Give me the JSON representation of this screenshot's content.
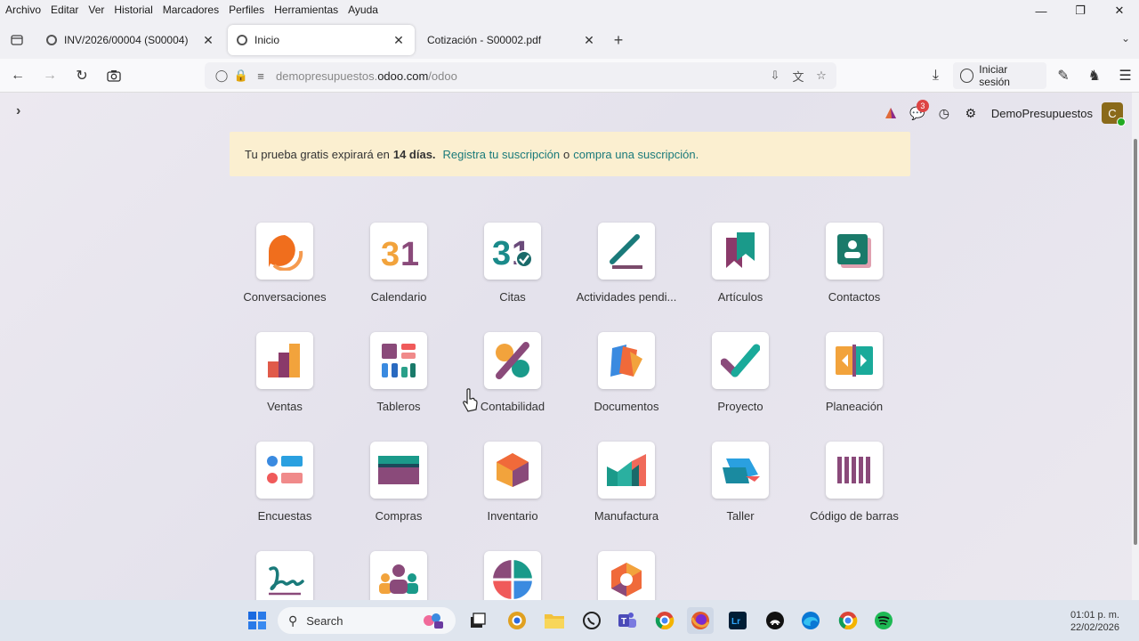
{
  "menubar": {
    "items": [
      "Archivo",
      "Editar",
      "Ver",
      "Historial",
      "Marcadores",
      "Perfiles",
      "Herramientas",
      "Ayuda"
    ]
  },
  "tabs": [
    {
      "title": "INV/2026/00004 (S00004)",
      "active": false
    },
    {
      "title": "Inicio",
      "active": true
    },
    {
      "title": "Cotización - S00002.pdf",
      "active": false
    }
  ],
  "urlbar": {
    "url_prefix": "demopresupuestos.",
    "url_domain": "odoo.com",
    "url_path": "/odoo"
  },
  "nav": {
    "signin_label": "Iniciar sesión"
  },
  "odoo": {
    "company": "DemoPresupuestos",
    "avatar_letter": "C",
    "chat_badge": "3",
    "trial": {
      "prefix": "Tu prueba gratis expirará en",
      "days": "14 días.",
      "link1": "Registra tu suscripción",
      "mid": "o",
      "link2": "compra una suscripción."
    },
    "apps": [
      {
        "label": "Conversaciones",
        "icon": "conversations-icon"
      },
      {
        "label": "Calendario",
        "icon": "calendar-icon"
      },
      {
        "label": "Citas",
        "icon": "appointments-icon"
      },
      {
        "label": "Actividades pendi...",
        "icon": "activities-icon"
      },
      {
        "label": "Artículos",
        "icon": "articles-icon"
      },
      {
        "label": "Contactos",
        "icon": "contacts-icon"
      },
      {
        "label": "Ventas",
        "icon": "sales-icon"
      },
      {
        "label": "Tableros",
        "icon": "dashboards-icon"
      },
      {
        "label": "Contabilidad",
        "icon": "accounting-icon"
      },
      {
        "label": "Documentos",
        "icon": "documents-icon"
      },
      {
        "label": "Proyecto",
        "icon": "project-icon"
      },
      {
        "label": "Planeación",
        "icon": "planning-icon"
      },
      {
        "label": "Encuestas",
        "icon": "surveys-icon"
      },
      {
        "label": "Compras",
        "icon": "purchase-icon"
      },
      {
        "label": "Inventario",
        "icon": "inventory-icon"
      },
      {
        "label": "Manufactura",
        "icon": "manufacturing-icon"
      },
      {
        "label": "Taller",
        "icon": "repair-icon"
      },
      {
        "label": "Código de barras",
        "icon": "barcode-icon"
      },
      {
        "label": "",
        "icon": "sign-icon"
      },
      {
        "label": "",
        "icon": "employees-icon"
      },
      {
        "label": "",
        "icon": "pie-icon"
      },
      {
        "label": "",
        "icon": "hexagon-icon"
      }
    ]
  },
  "taskbar": {
    "search_label": "Search",
    "time": "01:01 p. m.",
    "date": "22/02/2026"
  },
  "colors": {
    "accent_teal": "#1a7a7a",
    "trial_bg": "#fbefd0",
    "badge_red": "#d44"
  }
}
